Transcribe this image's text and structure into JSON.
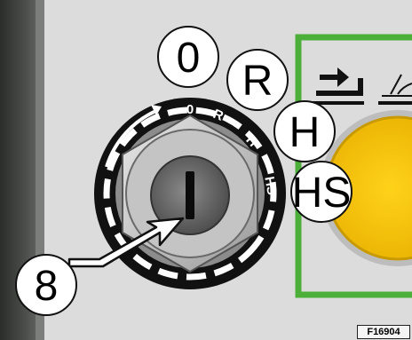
{
  "figure": {
    "callouts": {
      "position_0": "0",
      "position_r": "R",
      "position_h": "H",
      "position_hs": "HS",
      "item_number": "8"
    },
    "switch_ring_labels": {
      "position_0": "0",
      "position_r": "R",
      "position_h": "H",
      "position_hs": "HS"
    },
    "figure_code": "F16904"
  },
  "colors": {
    "panel": "#dcdcdc",
    "left_frame": "#3f423f",
    "green_frame": "#4caf3a",
    "yellow_button": "#f5c300"
  },
  "icons": [
    "retract-arrow-icon",
    "tilt-icon",
    "key-slot-icon",
    "pointer-arrow-icon"
  ]
}
